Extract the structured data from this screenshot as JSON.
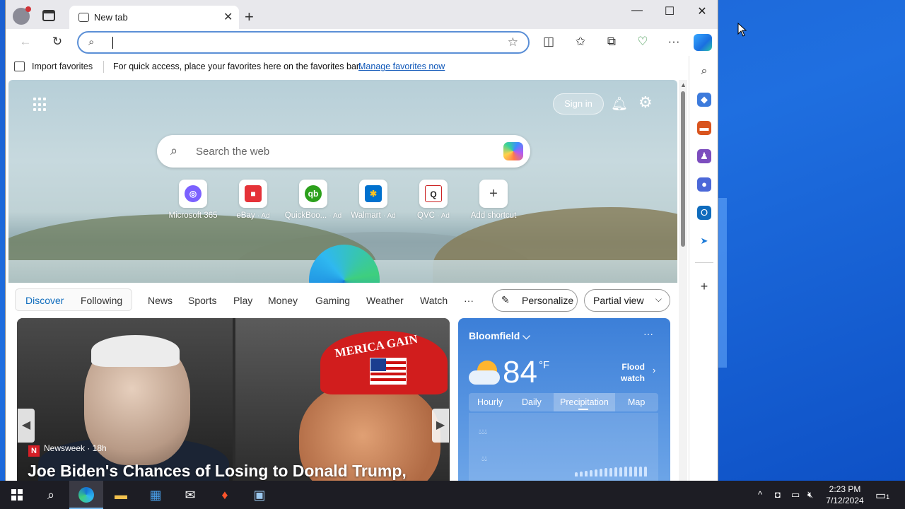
{
  "browser": {
    "tab_title": "New tab",
    "favbar": {
      "import_label": "Import favorites",
      "message": "For quick access, place your favorites here on the favorites bar.",
      "manage_link": "Manage favorites now"
    }
  },
  "newtab": {
    "sign_in": "Sign in",
    "search_placeholder": "Search the web",
    "shortcuts": [
      {
        "label": "Microsoft 365",
        "ad": "",
        "icon": "m365-icon",
        "color": "#7b61ff"
      },
      {
        "label": "eBay",
        "ad": "· Ad",
        "icon": "ebay-icon",
        "color": "#e53238"
      },
      {
        "label": "QuickBoo...",
        "ad": "· Ad",
        "icon": "quickbooks-icon",
        "color": "#2ca01c"
      },
      {
        "label": "Walmart",
        "ad": "· Ad",
        "icon": "walmart-icon",
        "color": "#0071ce"
      },
      {
        "label": "QVC",
        "ad": "· Ad",
        "icon": "qvc-icon",
        "color": "#e0e0e0"
      },
      {
        "label": "Add shortcut",
        "ad": "",
        "icon": "plus-icon",
        "color": "#ffffff"
      }
    ],
    "nav": {
      "discover": "Discover",
      "following": "Following",
      "items": [
        "News",
        "Sports",
        "Play",
        "Money",
        "Gaming",
        "Weather",
        "Watch"
      ],
      "more": "···",
      "personalize": "Personalize",
      "partial_view": "Partial view"
    },
    "news": {
      "source": "Newsweek · 18h",
      "source_badge": "N",
      "cap_text": "MERICA GAIN",
      "headline": "Joe Biden's Chances of Losing to Donald Trump, According to Polls"
    },
    "weather": {
      "location": "Bloomfield",
      "temp": "84",
      "unit": "°F",
      "alert_line1": "Flood",
      "alert_line2": "watch",
      "tabs": [
        "Hourly",
        "Daily",
        "Precipitation",
        "Map"
      ]
    }
  },
  "taskbar": {
    "time": "2:23 PM",
    "date": "7/12/2024",
    "notif_count": "1"
  },
  "colors": {
    "accent": "#0f6cbd",
    "desktop": "#1f6fe0",
    "taskbar": "#1d1d24"
  }
}
